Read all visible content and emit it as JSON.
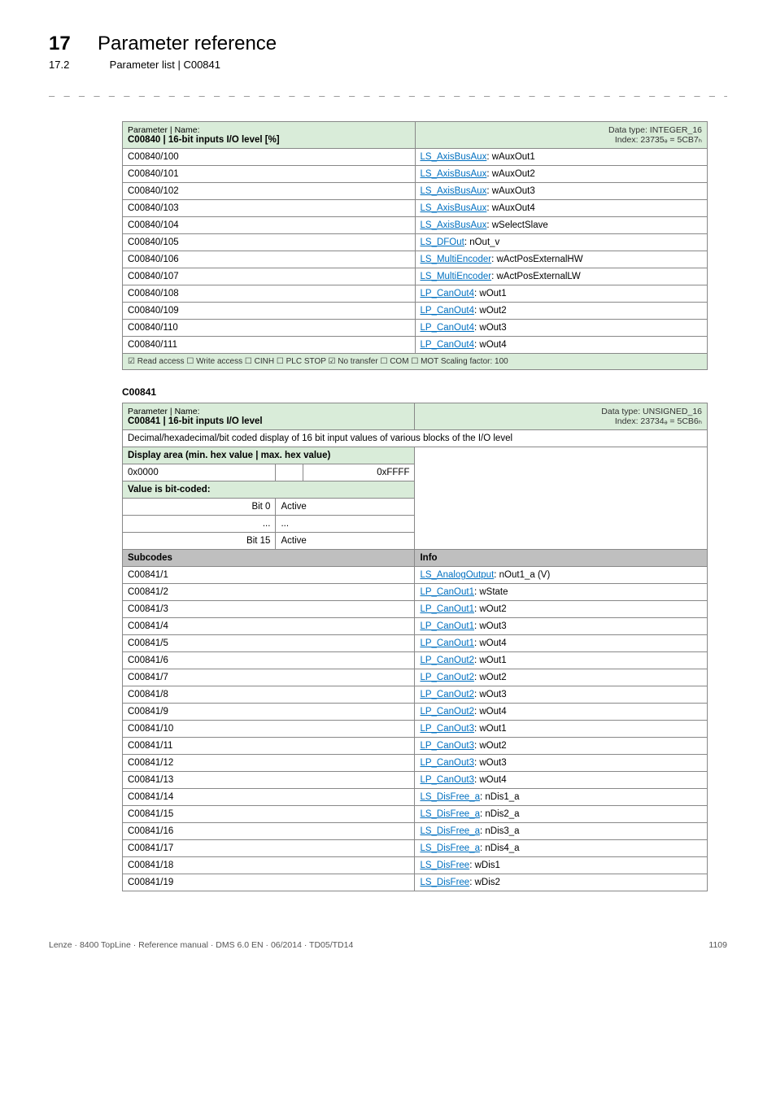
{
  "header": {
    "chapterNum": "17",
    "chapterTitle": "Parameter reference",
    "sectionNum": "17.2",
    "sectionTitle": "Parameter list | C00841",
    "dashes": "_ _ _ _ _ _ _ _ _ _ _ _ _ _ _ _ _ _ _ _ _ _ _ _ _ _ _ _ _ _ _ _ _ _ _ _ _ _ _ _ _ _ _ _ _ _ _ _ _ _ _ _ _ _ _ _ _ _ _ _ _ _ _ _"
  },
  "table1": {
    "paramLine1": "Parameter | Name:",
    "paramLine2": "C00840 | 16-bit inputs I/O level [%]",
    "typeLine1": "Data type: INTEGER_16",
    "typeLine2": "Index: 23735ₔ = 5CB7ₕ",
    "rows": [
      {
        "code": "C00840/100",
        "link": "LS_AxisBusAux",
        "rest": ": wAuxOut1"
      },
      {
        "code": "C00840/101",
        "link": "LS_AxisBusAux",
        "rest": ": wAuxOut2"
      },
      {
        "code": "C00840/102",
        "link": "LS_AxisBusAux",
        "rest": ": wAuxOut3"
      },
      {
        "code": "C00840/103",
        "link": "LS_AxisBusAux",
        "rest": ": wAuxOut4"
      },
      {
        "code": "C00840/104",
        "link": "LS_AxisBusAux",
        "rest": ": wSelectSlave"
      },
      {
        "code": "C00840/105",
        "link": "LS_DFOut",
        "rest": ": nOut_v"
      },
      {
        "code": "C00840/106",
        "link": "LS_MultiEncoder",
        "rest": ": wActPosExternalHW"
      },
      {
        "code": "C00840/107",
        "link": "LS_MultiEncoder",
        "rest": ": wActPosExternalLW"
      },
      {
        "code": "C00840/108",
        "link": "LP_CanOut4",
        "rest": ": wOut1"
      },
      {
        "code": "C00840/109",
        "link": "LP_CanOut4",
        "rest": ": wOut2"
      },
      {
        "code": "C00840/110",
        "link": "LP_CanOut4",
        "rest": ": wOut3"
      },
      {
        "code": "C00840/111",
        "link": "LP_CanOut4",
        "rest": ": wOut4"
      }
    ],
    "footer": "☑ Read access  ☐ Write access  ☐ CINH  ☐ PLC STOP  ☑ No transfer  ☐ COM  ☐ MOT   Scaling factor: 100"
  },
  "sectionLabel": "C00841",
  "table2": {
    "paramLine1": "Parameter | Name:",
    "paramLine2": "C00841 | 16-bit inputs I/O level",
    "typeLine1": "Data type: UNSIGNED_16",
    "typeLine2": "Index: 23734ₔ = 5CB6ₕ",
    "descRow": "Decimal/hexadecimal/bit coded display of 16 bit input values of various blocks of the I/O level",
    "displayAreaLabel": "Display area (min. hex value | max. hex value)",
    "minHex": "0x0000",
    "maxHex": "0xFFFF",
    "bitCodedLabel": "Value is bit-coded:",
    "bit0Key": "Bit 0",
    "bit0Val": "Active",
    "ellipsisKey": "...",
    "ellipsisVal": "...",
    "bit15Key": "Bit 15",
    "bit15Val": "Active",
    "subcodesHeader": "Subcodes",
    "infoHeader": "Info",
    "rows": [
      {
        "code": "C00841/1",
        "link": "LS_AnalogOutput",
        "rest": ": nOut1_a (V)"
      },
      {
        "code": "C00841/2",
        "link": "LP_CanOut1",
        "rest": ": wState"
      },
      {
        "code": "C00841/3",
        "link": "LP_CanOut1",
        "rest": ": wOut2"
      },
      {
        "code": "C00841/4",
        "link": "LP_CanOut1",
        "rest": ": wOut3"
      },
      {
        "code": "C00841/5",
        "link": "LP_CanOut1",
        "rest": ": wOut4"
      },
      {
        "code": "C00841/6",
        "link": "LP_CanOut2",
        "rest": ": wOut1"
      },
      {
        "code": "C00841/7",
        "link": "LP_CanOut2",
        "rest": ": wOut2"
      },
      {
        "code": "C00841/8",
        "link": "LP_CanOut2",
        "rest": ": wOut3"
      },
      {
        "code": "C00841/9",
        "link": "LP_CanOut2",
        "rest": ": wOut4"
      },
      {
        "code": "C00841/10",
        "link": "LP_CanOut3",
        "rest": ": wOut1"
      },
      {
        "code": "C00841/11",
        "link": "LP_CanOut3",
        "rest": ": wOut2"
      },
      {
        "code": "C00841/12",
        "link": "LP_CanOut3",
        "rest": ": wOut3"
      },
      {
        "code": "C00841/13",
        "link": "LP_CanOut3",
        "rest": ": wOut4"
      },
      {
        "code": "C00841/14",
        "link": "LS_DisFree_a",
        "rest": ": nDis1_a"
      },
      {
        "code": "C00841/15",
        "link": "LS_DisFree_a",
        "rest": ": nDis2_a"
      },
      {
        "code": "C00841/16",
        "link": "LS_DisFree_a",
        "rest": ": nDis3_a"
      },
      {
        "code": "C00841/17",
        "link": "LS_DisFree_a",
        "rest": ": nDis4_a"
      },
      {
        "code": "C00841/18",
        "link": "LS_DisFree",
        "rest": ": wDis1"
      },
      {
        "code": "C00841/19",
        "link": "LS_DisFree",
        "rest": ": wDis2"
      }
    ]
  },
  "footer": {
    "left": "Lenze · 8400 TopLine · Reference manual · DMS 6.0 EN · 06/2014 · TD05/TD14",
    "right": "1109"
  }
}
